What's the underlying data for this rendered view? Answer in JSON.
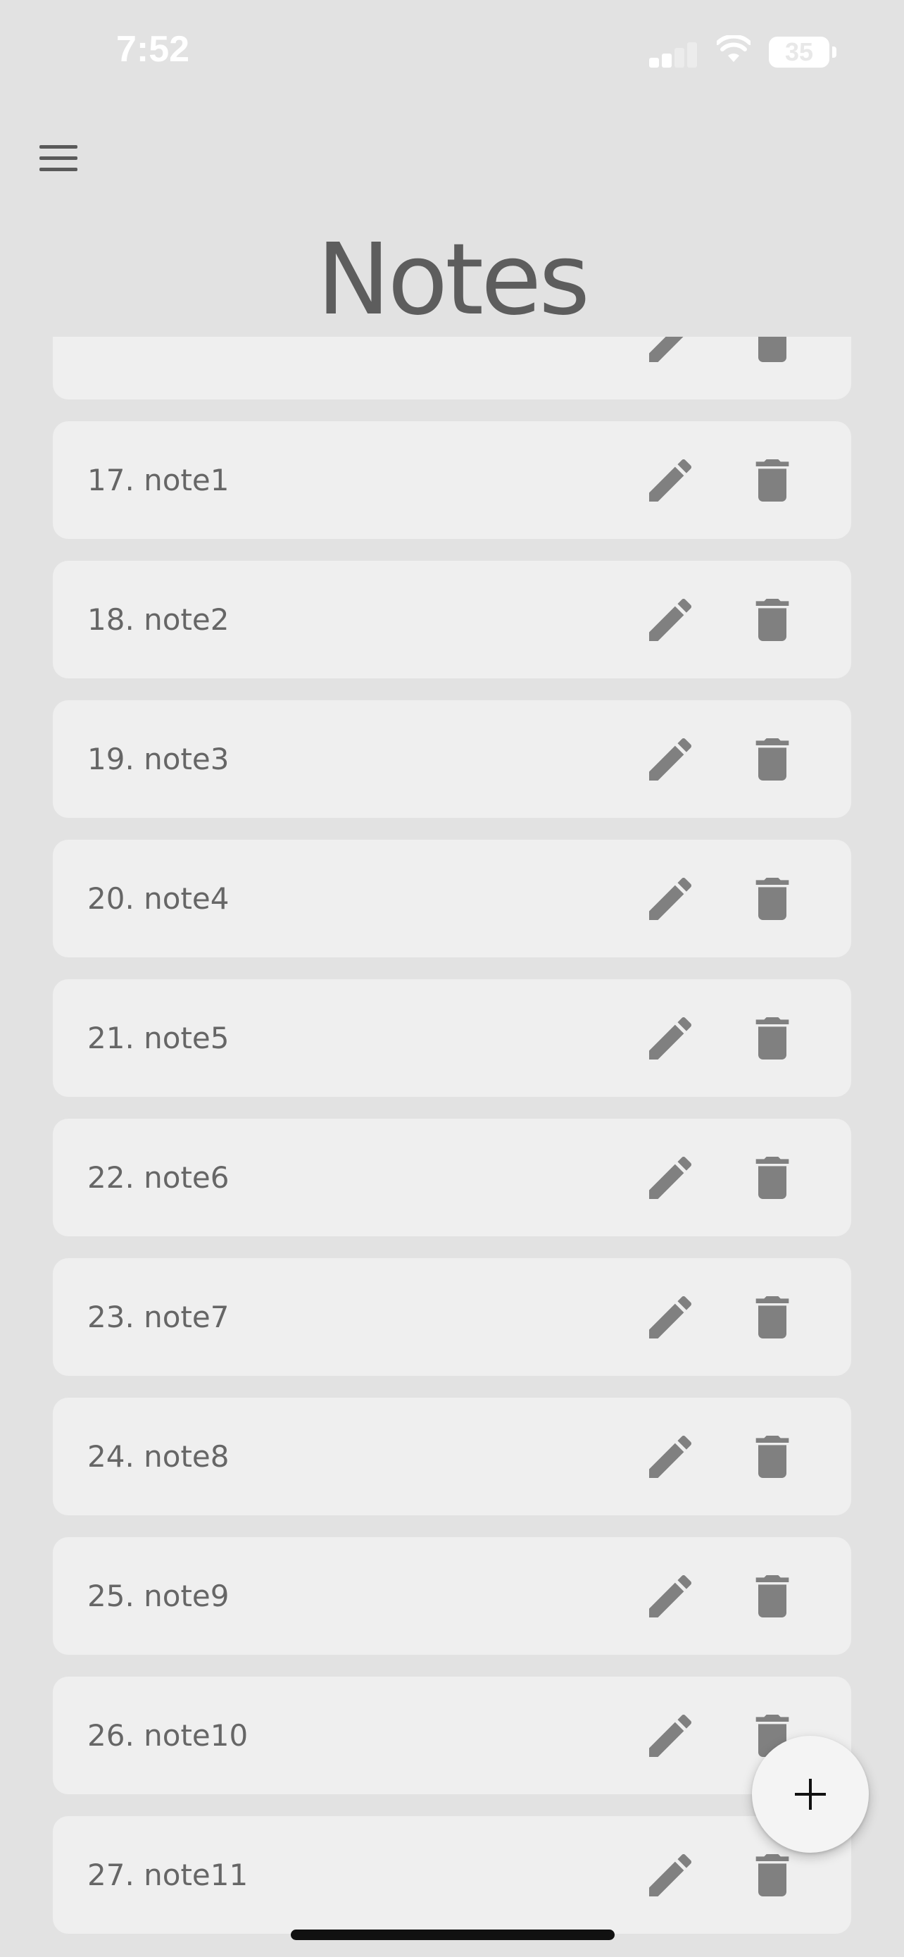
{
  "status_bar": {
    "time": "7:52",
    "battery": "35",
    "signal_icon": "cellular-signal-icon",
    "wifi_icon": "wifi-icon",
    "battery_icon": "battery-icon"
  },
  "header": {
    "menu_icon": "hamburger-menu-icon",
    "title": "Notes"
  },
  "notes": [
    {
      "label": ""
    },
    {
      "label": "17. note1"
    },
    {
      "label": "18. note2"
    },
    {
      "label": "19. note3"
    },
    {
      "label": "20. note4"
    },
    {
      "label": "21. note5"
    },
    {
      "label": "22. note6"
    },
    {
      "label": "23. note7"
    },
    {
      "label": "24. note8"
    },
    {
      "label": "25. note9"
    },
    {
      "label": "26. note10"
    },
    {
      "label": "27. note11"
    }
  ],
  "note_actions": {
    "edit_icon": "pencil-icon",
    "delete_icon": "trash-icon"
  },
  "fab": {
    "icon": "plus-icon"
  },
  "colors": {
    "background": "#e2e2e2",
    "card": "#efefef",
    "text": "#666666",
    "title": "#5d5d5d",
    "icon": "#808080"
  }
}
